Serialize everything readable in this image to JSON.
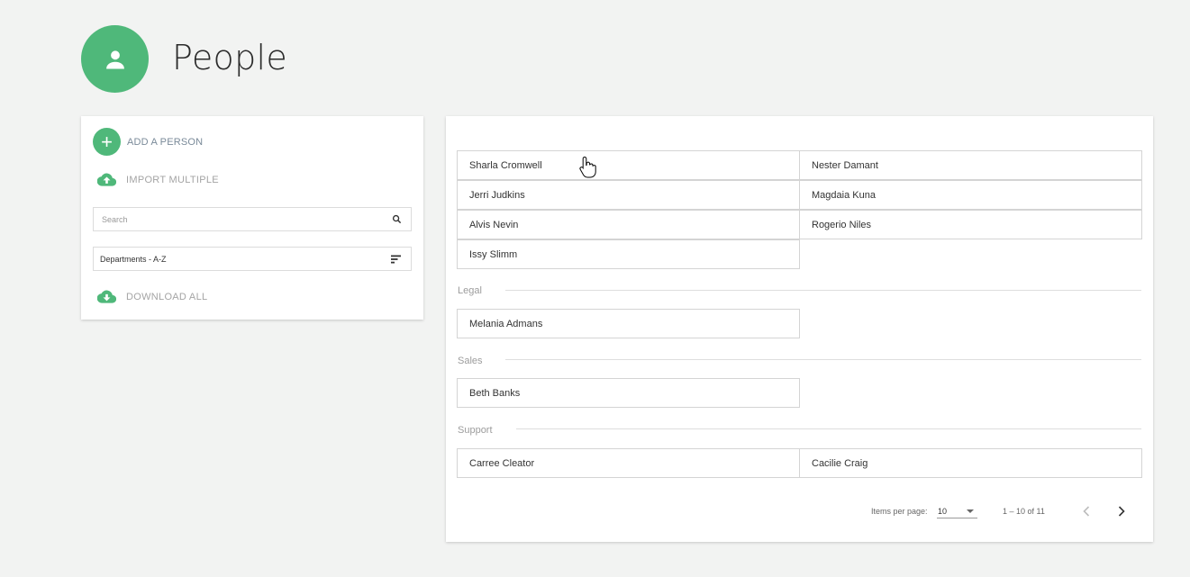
{
  "header": {
    "title": "People",
    "avatar_icon": "person-icon"
  },
  "sidebar": {
    "add_label": "ADD A PERSON",
    "import_label": "IMPORT MULTIPLE",
    "search_placeholder": "Search",
    "sort_value": "Departments - A-Z",
    "download_label": "DOWNLOAD ALL"
  },
  "departments": [
    {
      "name": "",
      "people": [
        "Sharla Cromwell",
        "Nester Damant",
        "Jerri Judkins",
        "Magdaia Kuna",
        "Alvis Nevin",
        "Rogerio Niles",
        "Issy Slimm"
      ]
    },
    {
      "name": "Legal",
      "people": [
        "Melania Admans"
      ]
    },
    {
      "name": "Sales",
      "people": [
        "Beth Banks"
      ]
    },
    {
      "name": "Support",
      "people": [
        "Carree Cleator",
        "Cacilie Craig"
      ]
    }
  ],
  "paginator": {
    "items_per_page_label": "Items per page:",
    "page_size": "10",
    "range": "1 – 10 of 11"
  },
  "colors": {
    "accent": "#4fb87a",
    "background": "#f2f3f2"
  }
}
